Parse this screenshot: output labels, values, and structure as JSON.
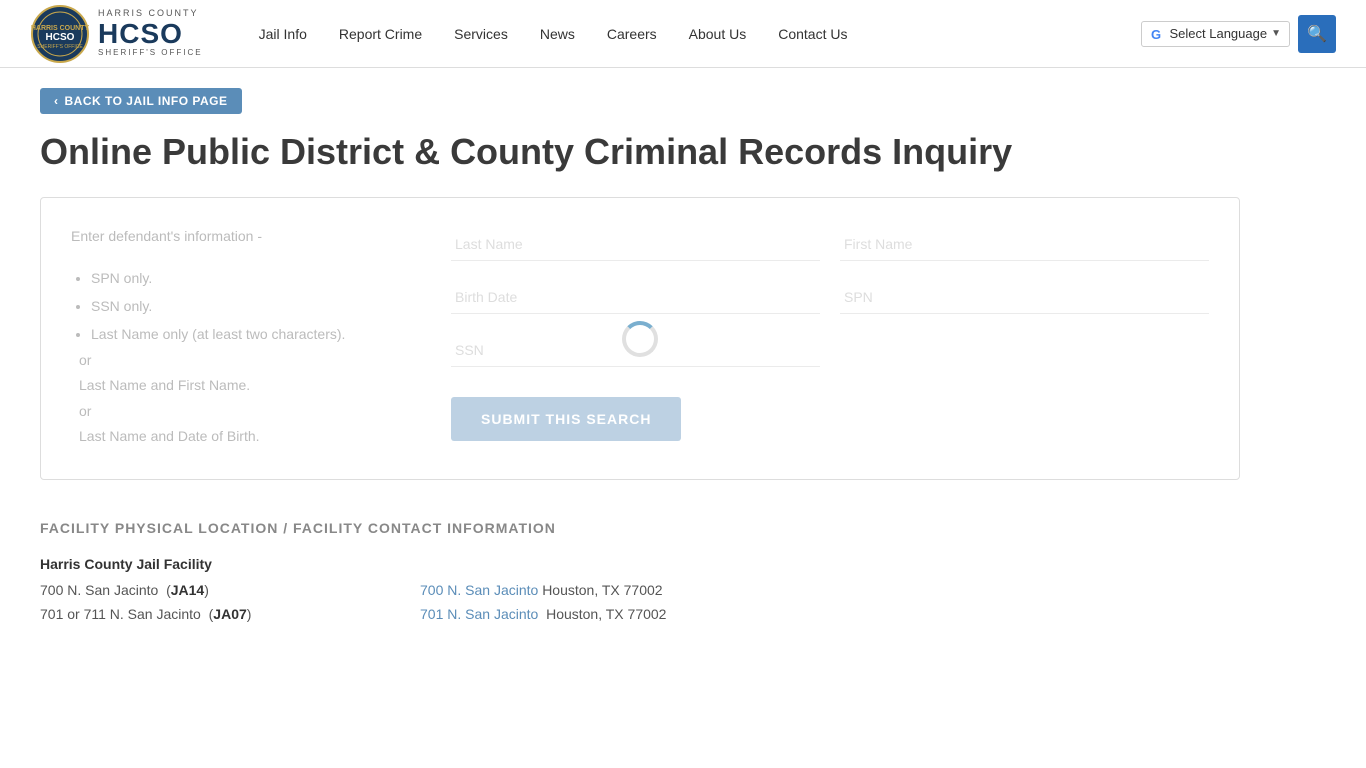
{
  "header": {
    "logo": {
      "top_text": "HARRIS COUNTY",
      "main_text": "HCSO",
      "sub_text": "SHERIFF'S OFFICE"
    },
    "nav": [
      {
        "label": "Jail Info",
        "id": "jail-info"
      },
      {
        "label": "Report Crime",
        "id": "report-crime"
      },
      {
        "label": "Services",
        "id": "services"
      },
      {
        "label": "News",
        "id": "news"
      },
      {
        "label": "Careers",
        "id": "careers"
      },
      {
        "label": "About Us",
        "id": "about-us"
      },
      {
        "label": "Contact Us",
        "id": "contact-us"
      }
    ],
    "translate_label": "Select Language",
    "search_placeholder": "Search"
  },
  "breadcrumb": {
    "back_label": "BACK TO JAIL INFO PAGE"
  },
  "page": {
    "title": "Online Public District & County Criminal Records Inquiry"
  },
  "form": {
    "instructions_heading": "Enter defendant's information -",
    "instructions": [
      "SPN only.",
      "SSN only.",
      "Last Name only (at least two characters)."
    ],
    "instructions_extra": [
      "or",
      "Last Name and First Name.",
      "or",
      "Last Name and Date of Birth."
    ],
    "fields": {
      "last_name_placeholder": "Last Name",
      "first_name_placeholder": "First Name",
      "birth_date_placeholder": "Birth Date",
      "spn_placeholder": "SPN",
      "ssn_placeholder": "SSN"
    },
    "submit_label": "SUBMIT THIS SEARCH"
  },
  "facility": {
    "section_heading": "FACILITY PHYSICAL LOCATION / FACILITY CONTACT INFORMATION",
    "name": "Harris County Jail Facility",
    "locations": [
      {
        "address": "700 N. San Jacinto",
        "code": "JA14",
        "link_text": "700 N. San Jacinto",
        "city_state_zip": "Houston, TX 77002"
      },
      {
        "address": "701 or 711 N. San Jacinto",
        "code": "JA07",
        "link_text": "701 N. San Jacinto",
        "city_state_zip": "Houston, TX 77002"
      }
    ]
  }
}
